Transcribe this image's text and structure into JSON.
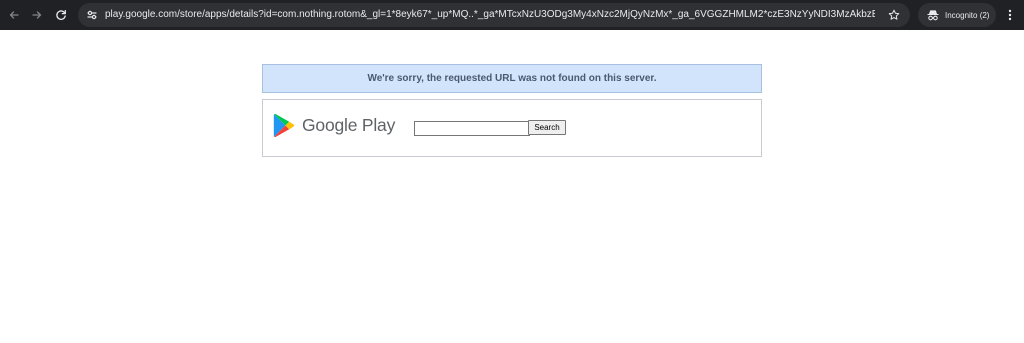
{
  "browser": {
    "url": "play.google.com/store/apps/details?id=com.nothing.rotom&_gl=1*8eyk67*_up*MQ..*_ga*MTcxNzU3ODg3My4xNzc2MjQyNzMx*_ga_6VGGZHMLM2*czE3NzYyNDI3MzAkbzEkZzAkdDE3N...",
    "incognito_label": "Incognito (2)",
    "icons": {
      "back": "arrow-left-icon",
      "forward": "arrow-right-icon",
      "reload": "reload-icon",
      "site_info": "tune-icon",
      "bookmark": "star-icon",
      "incognito": "incognito-icon",
      "menu": "more-vert-icon"
    },
    "colors": {
      "toolbar": "#202124",
      "omnibox": "#303134",
      "text": "#e8eaed"
    }
  },
  "page": {
    "error_message": "We're sorry, the requested URL was not found on this server.",
    "logo_text": "Google Play",
    "search": {
      "value": "",
      "button_label": "Search"
    },
    "colors": {
      "banner_bg": "#d2e3fc",
      "banner_text": "#4a5a6e"
    }
  }
}
